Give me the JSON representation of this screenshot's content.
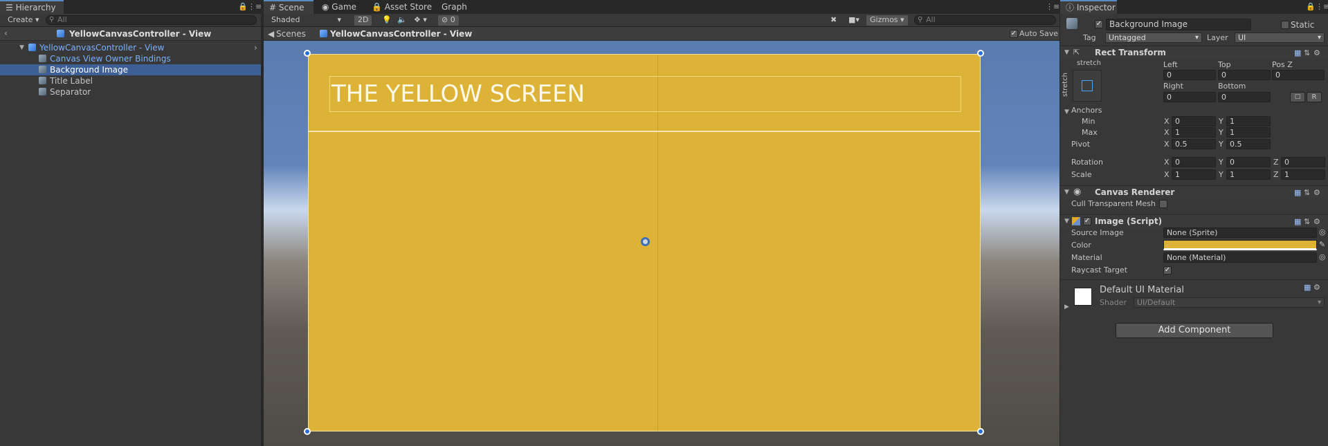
{
  "hierarchy": {
    "tab": "Hierarchy",
    "create": "Create",
    "search_placeholder": "All",
    "scene_title": "YellowCanvasController - View",
    "items": [
      {
        "label": "YellowCanvasController - View"
      },
      {
        "label": "Canvas View Owner Bindings"
      },
      {
        "label": "Background Image"
      },
      {
        "label": "Title Label"
      },
      {
        "label": "Separator"
      }
    ]
  },
  "scene": {
    "tabs": [
      "Scene",
      "Game",
      "Asset Store",
      "Graph"
    ],
    "shading": "Shaded",
    "mode_2d": "2D",
    "hidden_count": "0",
    "gizmos": "Gizmos",
    "search_placeholder": "All",
    "breadcrumb_root": "Scenes",
    "breadcrumb_current": "YellowCanvasController - View",
    "auto_save": "Auto Save",
    "canvas_title": "THE YELLOW SCREEN",
    "canvas_color": "#dcb337"
  },
  "inspector": {
    "tab": "Inspector",
    "object_name": "Background Image",
    "static_label": "Static",
    "tag_label": "Tag",
    "tag_value": "Untagged",
    "layer_label": "Layer",
    "layer_value": "UI",
    "rect_transform": {
      "title": "Rect Transform",
      "stretch_h": "stretch",
      "stretch_v": "stretch",
      "left_label": "Left",
      "left": "0",
      "top_label": "Top",
      "top": "0",
      "posz_label": "Pos Z",
      "posz": "0",
      "right_label": "Right",
      "right": "0",
      "bottom_label": "Bottom",
      "bottom": "0",
      "r_button": "R",
      "anchors_label": "Anchors",
      "min_label": "Min",
      "min_x": "0",
      "min_y": "1",
      "max_label": "Max",
      "max_x": "1",
      "max_y": "1",
      "pivot_label": "Pivot",
      "pivot_x": "0.5",
      "pivot_y": "0.5",
      "rotation_label": "Rotation",
      "rot_x": "0",
      "rot_y": "0",
      "rot_z": "0",
      "scale_label": "Scale",
      "scale_x": "1",
      "scale_y": "1",
      "scale_z": "1",
      "x": "X",
      "y": "Y",
      "z": "Z"
    },
    "canvas_renderer": {
      "title": "Canvas Renderer",
      "cull_label": "Cull Transparent Mesh"
    },
    "image_script": {
      "title": "Image (Script)",
      "source_label": "Source Image",
      "source_value": "None (Sprite)",
      "color_label": "Color",
      "color_value": "#dcb337",
      "material_label": "Material",
      "material_value": "None (Material)",
      "raycast_label": "Raycast Target"
    },
    "material": {
      "name": "Default UI Material",
      "shader_label": "Shader",
      "shader_value": "UI/Default"
    },
    "add_component": "Add Component"
  }
}
